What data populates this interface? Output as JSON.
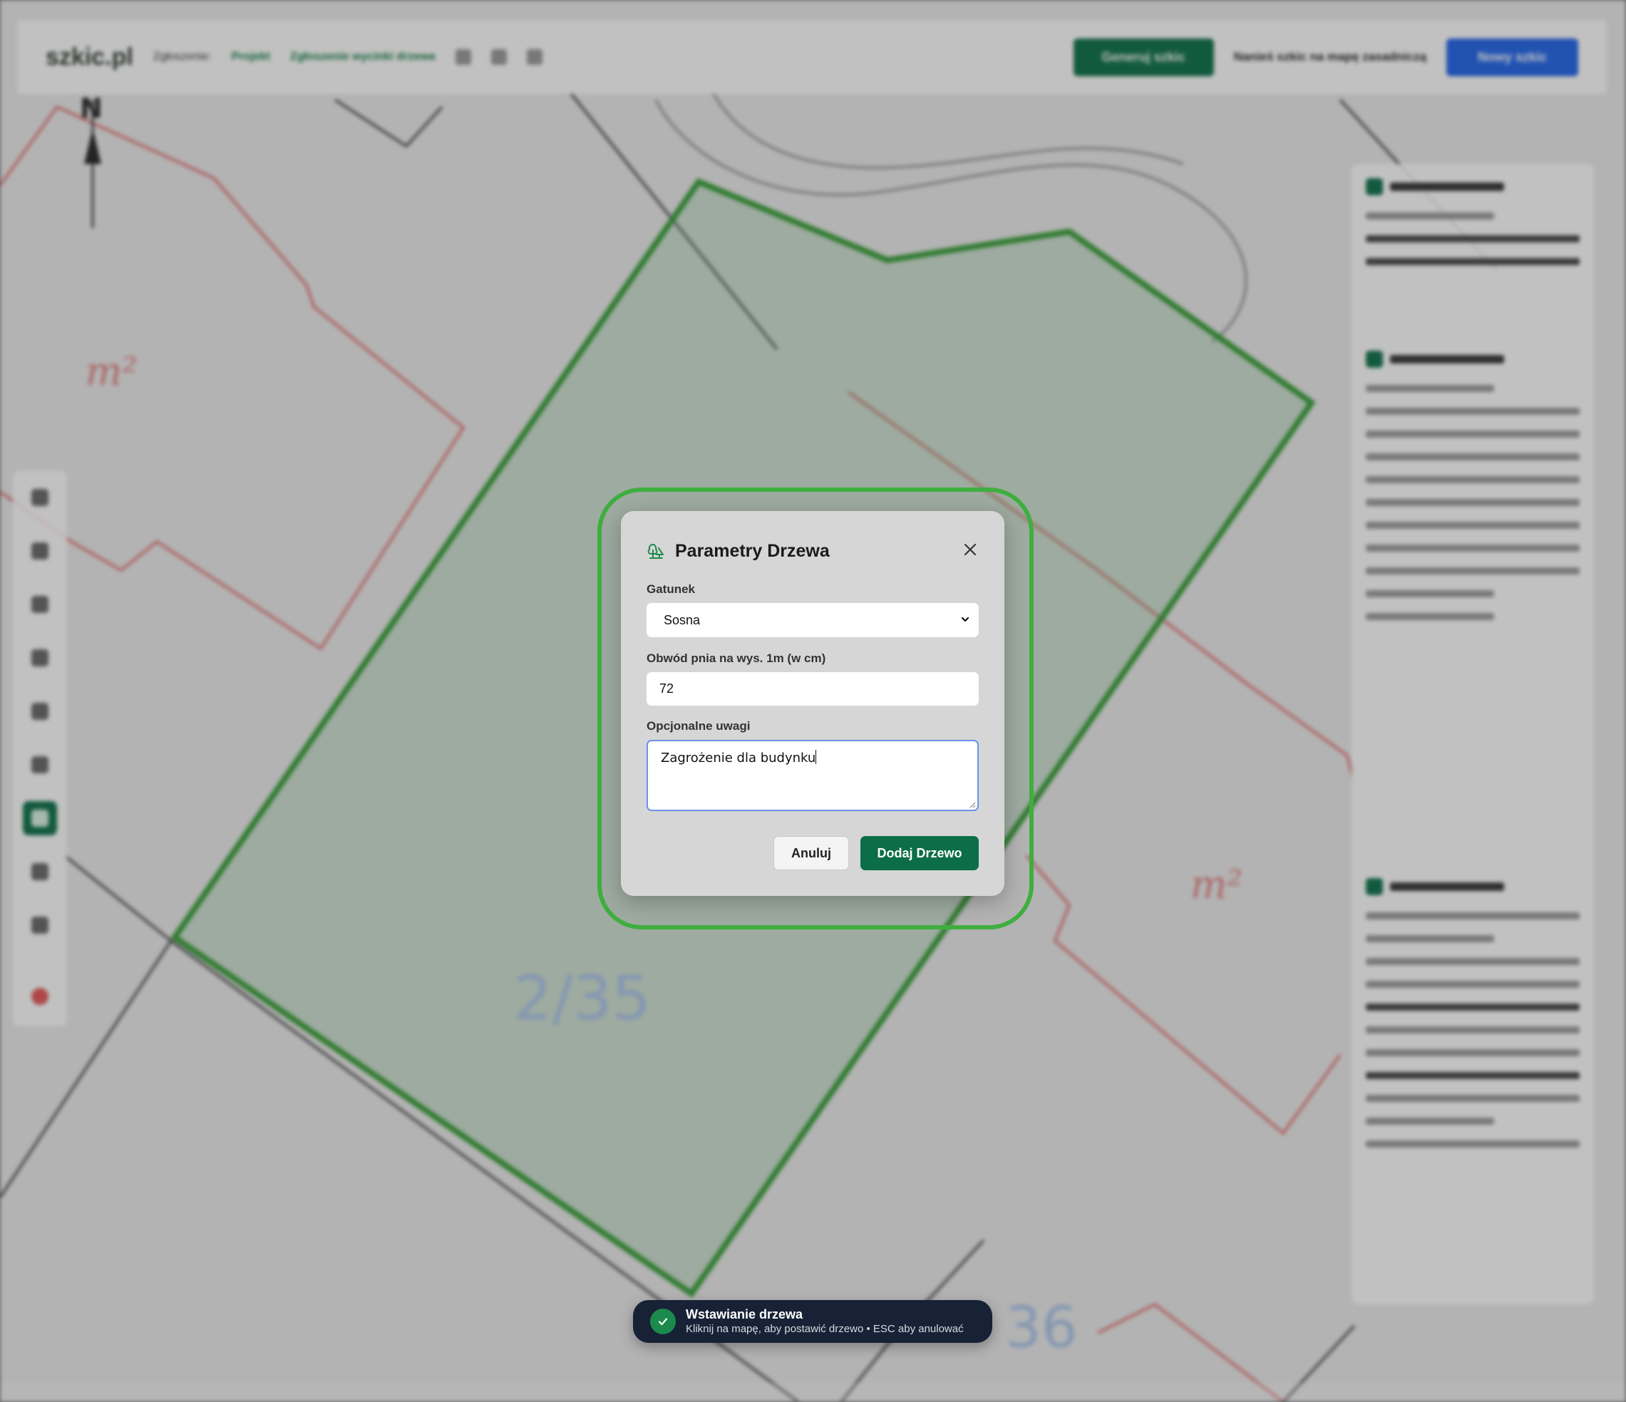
{
  "background": {
    "logo_text": "szkic.pl",
    "breadcrumb_1": "Zgłoszenie:",
    "breadcrumb_2": "Projekt",
    "breadcrumb_3": "Zgłoszenie wycinki drzewa",
    "generate_label": "Generuj szkic",
    "pdf_label": "Nanieś szkic na mapę zasadniczą",
    "save_label": "Nowy szkic",
    "map_parcel_label_1": "2/35",
    "map_parcel_label_2": "36",
    "map_area_label": "m²",
    "north_label": "N"
  },
  "modal": {
    "title": "Parametry Drzewa",
    "species_label": "Gatunek",
    "species_value": "Sosna",
    "species_options": [
      "Sosna"
    ],
    "circumference_label": "Obwód pnia na wys. 1m (w cm)",
    "circumference_value": "72",
    "notes_label": "Opcjonalne uwagi",
    "notes_value": "Zagrożenie dla budynku",
    "cancel_label": "Anuluj",
    "submit_label": "Dodaj Drzewo"
  },
  "toast": {
    "title": "Wstawianie drzewa",
    "message": "Kliknij na mapę, aby postawić drzewo • ESC aby anulować"
  },
  "colors": {
    "accent_green": "#0b6e48",
    "focus_ring": "#3fae3f",
    "parcel_outline": "#2f9a2f",
    "boundary_red": "#e05a5a",
    "toast_bg": "#172236"
  },
  "icons": {
    "modal_title_icon": "trees-icon",
    "close_icon": "close-icon",
    "toast_icon": "check-icon"
  }
}
